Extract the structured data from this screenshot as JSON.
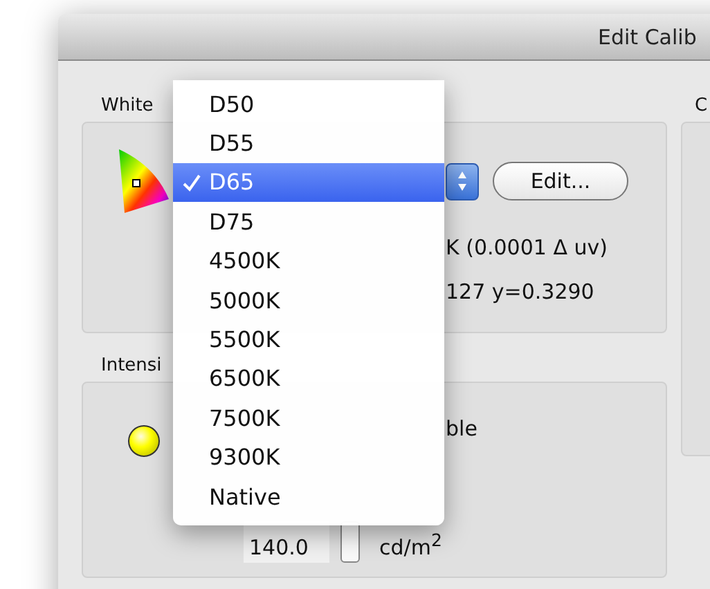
{
  "window": {
    "title": "Edit Calib"
  },
  "white_point": {
    "label": "White",
    "edit_button": "Edit...",
    "color_temp": "K (0.0001 Δ uv)",
    "cie_xy": "127 y=0.3290"
  },
  "right_group": {
    "label": "C"
  },
  "intensity": {
    "label": "Intensi",
    "option": "ble",
    "value": "140.0",
    "unit": "cd/m$^{2}$"
  },
  "menu": {
    "items": [
      {
        "label": "D50",
        "selected": false
      },
      {
        "label": "D55",
        "selected": false
      },
      {
        "label": "D65",
        "selected": true
      },
      {
        "label": "D75",
        "selected": false
      },
      {
        "label": "4500K",
        "selected": false
      },
      {
        "label": "5000K",
        "selected": false
      },
      {
        "label": "5500K",
        "selected": false
      },
      {
        "label": "6500K",
        "selected": false
      },
      {
        "label": "7500K",
        "selected": false
      },
      {
        "label": "9300K",
        "selected": false
      },
      {
        "label": "Native",
        "selected": false
      }
    ]
  }
}
